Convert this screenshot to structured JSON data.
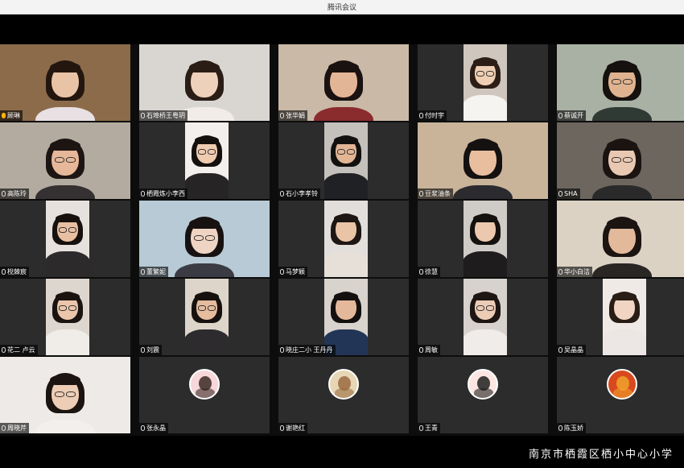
{
  "window": {
    "title": "腾讯会议"
  },
  "participants": [
    {
      "name": "顾琳",
      "bg": "#8c6b4a",
      "video": "full",
      "skin": "#e9c3a5",
      "shirt": "#e8e0e3",
      "hair": "#23160f",
      "glasses": false,
      "speaking": true
    },
    {
      "name": "石埠桥王粤玥",
      "bg": "#d9d6d2",
      "video": "full",
      "skin": "#eed1bb",
      "shirt": "#f1ece8",
      "hair": "#2a1d15",
      "glasses": false,
      "speaking": false
    },
    {
      "name": "张华娟",
      "bg": "#c9b9a6",
      "video": "full",
      "skin": "#e3b597",
      "shirt": "#8a2b2e",
      "hair": "#1a1210",
      "glasses": false,
      "speaking": false
    },
    {
      "name": "付时宇",
      "bg": "#cfc6bd",
      "video": "narrow",
      "skin": "#efcfb4",
      "shirt": "#f6f4f1",
      "hair": "#2c1e16",
      "glasses": true,
      "speaking": false
    },
    {
      "name": "蔡诚开",
      "bg": "#a9b1a4",
      "video": "full",
      "skin": "#e0b390",
      "shirt": "#2f3a34",
      "hair": "#15110e",
      "glasses": true,
      "speaking": false
    },
    {
      "name": "高陈玲",
      "bg": "#b4aba0",
      "video": "full",
      "skin": "#e6b799",
      "shirt": "#353031",
      "hair": "#1d1512",
      "glasses": true,
      "speaking": false
    },
    {
      "name": "栖霞炼小李西",
      "bg": "#f2efec",
      "video": "narrow",
      "skin": "#efcbb0",
      "shirt": "#272426",
      "hair": "#14100d",
      "glasses": true,
      "speaking": false
    },
    {
      "name": "石小李孝铃",
      "bg": "#c4c0bb",
      "video": "narrow",
      "skin": "#e2b595",
      "shirt": "#1f2125",
      "hair": "#131110",
      "glasses": true,
      "speaking": false
    },
    {
      "name": "豆浆油条",
      "bg": "#c9b49a",
      "video": "full",
      "skin": "#e8be9f",
      "shirt": "#2b2a2e",
      "hair": "#141110",
      "glasses": false,
      "speaking": false
    },
    {
      "name": "SHA",
      "bg": "#6d665f",
      "video": "full",
      "skin": "#e9c8b2",
      "shirt": "#2a2a2a",
      "hair": "#1a1310",
      "glasses": true,
      "speaking": false
    },
    {
      "name": "梲棘宸",
      "bg": "#e6e1dc",
      "video": "narrow",
      "skin": "#e9bfa2",
      "shirt": "#2d2a2c",
      "hair": "#17110e",
      "glasses": true,
      "speaking": false
    },
    {
      "name": "董繁妮",
      "bg": "#b7cad6",
      "video": "full",
      "skin": "#f0d4c3",
      "shirt": "#3b3b43",
      "hair": "#171211",
      "glasses": true,
      "speaking": false
    },
    {
      "name": "马梦颖",
      "bg": "#e2dedb",
      "video": "narrow",
      "skin": "#e9c4a7",
      "shirt": "#e6e0d9",
      "hair": "#1d1612",
      "glasses": false,
      "speaking": false
    },
    {
      "name": "徐慧",
      "bg": "#cfcbc6",
      "video": "narrow",
      "skin": "#ecc8ae",
      "shirt": "#1e1c1d",
      "hair": "#15110f",
      "glasses": false,
      "speaking": false
    },
    {
      "name": "华小白洁",
      "bg": "#dcd2c4",
      "video": "full",
      "skin": "#e3b99b",
      "shirt": "#2a2623",
      "hair": "#1b1411",
      "glasses": false,
      "speaking": false
    },
    {
      "name": "花二 卢云",
      "bg": "#ddd6cf",
      "video": "narrow",
      "skin": "#ecc6ab",
      "shirt": "#f0ede9",
      "hair": "#1a1310",
      "glasses": true,
      "speaking": false
    },
    {
      "name": "刘震",
      "bg": "#ddd5c9",
      "video": "narrow",
      "skin": "#e6bc9f",
      "shirt": "#2e2b2f",
      "hair": "#16110e",
      "glasses": true,
      "speaking": false
    },
    {
      "name": "晓庄二小 王丹丹",
      "bg": "#d9d3cd",
      "video": "narrow",
      "skin": "#e4b99b",
      "shirt": "#233557",
      "hair": "#141010",
      "glasses": false,
      "speaking": false
    },
    {
      "name": "周敏",
      "bg": "#d7d2ce",
      "video": "narrow",
      "skin": "#edccb6",
      "shirt": "#f0ecea",
      "hair": "#1d1612",
      "glasses": true,
      "speaking": false
    },
    {
      "name": "吴晶晶",
      "bg": "#efeae6",
      "video": "narrow",
      "skin": "#f1d5c2",
      "shirt": "#ece6e5",
      "hair": "#2a1d16",
      "glasses": false,
      "speaking": false
    },
    {
      "name": "周晓芹",
      "bg": "#eeeae7",
      "video": "full",
      "skin": "#eecdb6",
      "shirt": "#f2efed",
      "hair": "#1b1411",
      "glasses": true,
      "speaking": false
    },
    {
      "name": "张永晶",
      "bg": "#2c2c2c",
      "video": "avatar",
      "avatar_bg": "#f7d7d9",
      "avatar_fg": "#3b2a25",
      "speaking": false
    },
    {
      "name": "谢艳红",
      "bg": "#2c2c2c",
      "video": "avatar",
      "avatar_bg": "#e7d6b5",
      "avatar_fg": "#9a6b3f",
      "speaking": false
    },
    {
      "name": "王青",
      "bg": "#2c2c2c",
      "video": "avatar",
      "avatar_bg": "#fde6e2",
      "avatar_fg": "#1f1f1f",
      "speaking": false
    },
    {
      "name": "陈玉娇",
      "bg": "#2c2c2c",
      "video": "avatar",
      "avatar_bg": "#d84a1e",
      "avatar_fg": "#f1a22b",
      "speaking": false
    }
  ],
  "footer": {
    "caption": "南京市栖霞区栖小中心小学"
  },
  "colors": {
    "accent": "#ffb100",
    "tile": "#2c2c2c"
  }
}
